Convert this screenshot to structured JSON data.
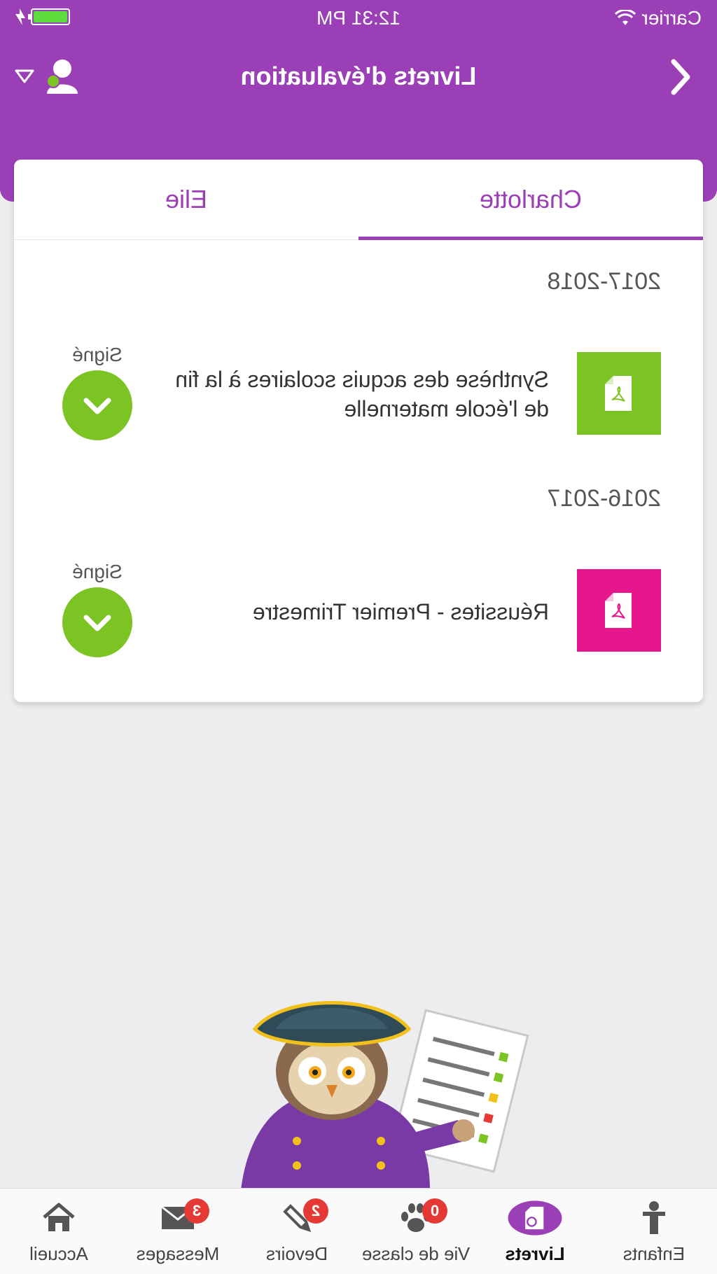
{
  "status_bar": {
    "carrier": "Carrier",
    "time": "12:31 PM"
  },
  "header": {
    "title": "Livrets d'évaluation"
  },
  "tabs": [
    {
      "label": "Charlotte",
      "active": true
    },
    {
      "label": "Elie",
      "active": false
    }
  ],
  "sections": [
    {
      "year": "2017-2018",
      "document": {
        "title": "Synthèse des acquis scolaires à la fin de l'école maternelle",
        "icon": "pdf-icon",
        "icon_color": "#7cc324",
        "status": "Signé"
      }
    },
    {
      "year": "2016-2017",
      "document": {
        "title": "Réussites - Premier Trimestre",
        "icon": "pdf-icon",
        "icon_color": "#e6168c",
        "status": "Signé"
      }
    }
  ],
  "tabbar": [
    {
      "label": "Accueil",
      "icon": "home-icon",
      "badge": ""
    },
    {
      "label": "Messages",
      "icon": "envelope-icon",
      "badge": "3"
    },
    {
      "label": "Devoirs",
      "icon": "pencil-icon",
      "badge": "2"
    },
    {
      "label": "Vie de classe",
      "icon": "paw-icon",
      "badge": "0"
    },
    {
      "label": "Livrets",
      "icon": "booklet-icon",
      "badge": "",
      "active": true
    },
    {
      "label": "Enfants",
      "icon": "child-icon",
      "badge": ""
    }
  ],
  "colors": {
    "brand_purple": "#9b3fb6",
    "success_green": "#7cc324",
    "pink": "#e6168c",
    "badge_red": "#e53935"
  }
}
